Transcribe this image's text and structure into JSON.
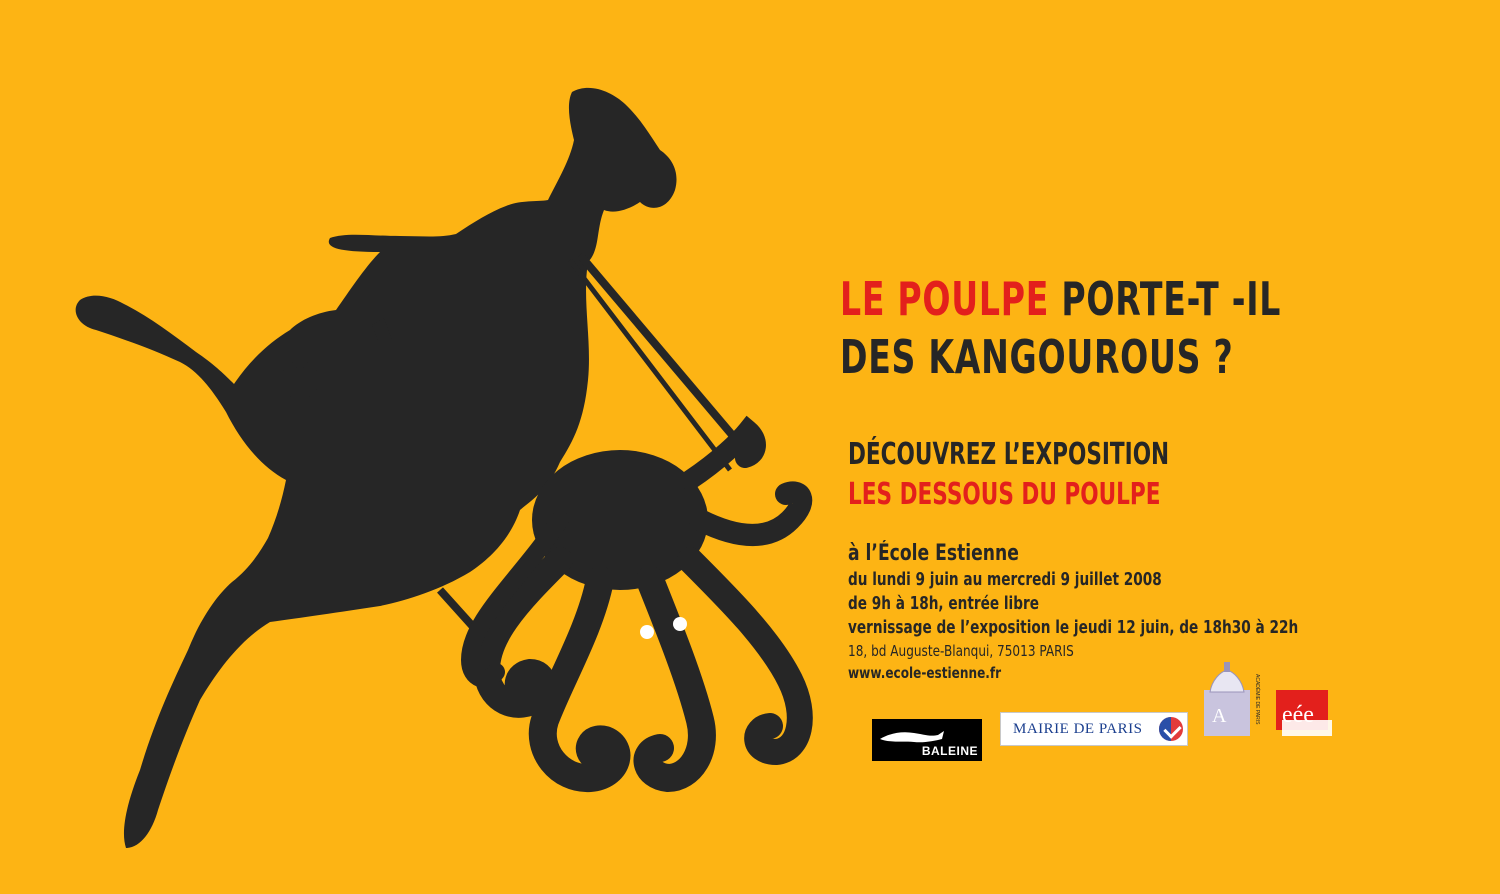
{
  "headline": {
    "line1_red": "LE POULPE",
    "line1_rest": " PORTE-T -IL",
    "line2": "DES KANGOUROUS ?"
  },
  "subhead": {
    "line1": "DÉCOUVREZ L’EXPOSITION",
    "line2": "LES DESSOUS DU POULPE"
  },
  "details": {
    "school": "à l’École Estienne",
    "dates": "du lundi 9 juin au mercredi 9 juillet 2008",
    "hours": "de 9h à 18h, entrée libre",
    "opening": "vernissage de l’exposition le jeudi 12 juin, de 18h30 à 22h",
    "address": "18, bd Auguste-Blanqui, 75013 PARIS",
    "url": "www.ecole-estienne.fr"
  },
  "logos": {
    "baleine": "BALEINE",
    "mairie": "MAIRIE DE PARIS",
    "academie": "ACADÉMIE DE PARIS",
    "eee": "eée"
  },
  "colors": {
    "background": "#FDB414",
    "ink": "#262626",
    "accent_red": "#E3201C"
  },
  "icons": [
    "kangaroo-silhouette",
    "octopus-silhouette",
    "whale-diver-logo",
    "mairie-de-paris-mark"
  ]
}
